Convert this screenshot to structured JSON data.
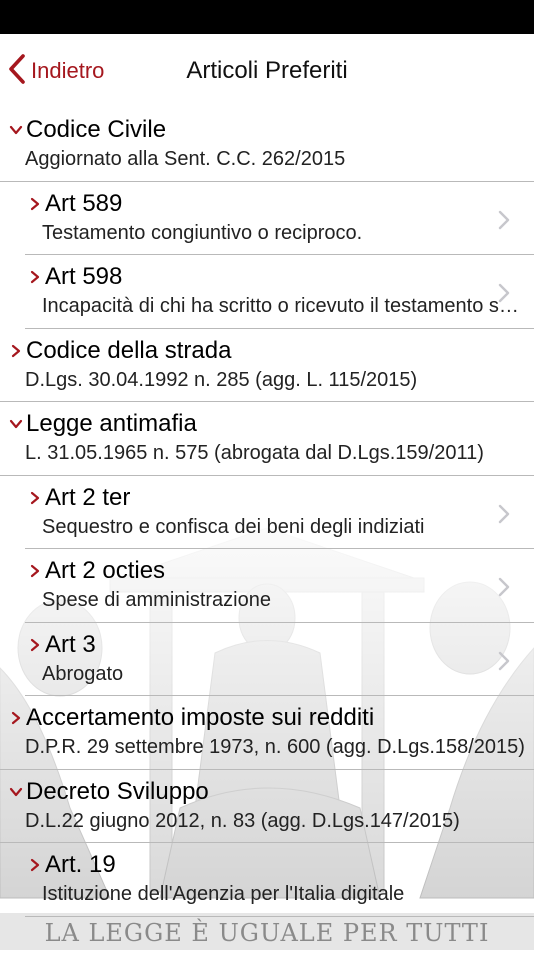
{
  "nav": {
    "back_label": "Indietro",
    "title": "Articoli Preferiti"
  },
  "colors": {
    "accent": "#a5171e",
    "caret": "#a5171e",
    "chevron": "#c7c7cc"
  },
  "rows": [
    {
      "level": 0,
      "expanded": true,
      "title": "Codice Civile",
      "subtitle": "Aggiornato alla Sent. C.C. 262/2015"
    },
    {
      "level": 1,
      "expanded": false,
      "title": "Art 589",
      "subtitle": "Testamento congiuntivo o reciproco.",
      "chevron": true
    },
    {
      "level": 1,
      "expanded": false,
      "title": "Art 598",
      "subtitle": "Incapacità di chi ha scritto o ricevuto il testamento segreto.",
      "chevron": true
    },
    {
      "level": 0,
      "expanded": false,
      "title": "Codice della strada",
      "subtitle": "D.Lgs. 30.04.1992 n. 285 (agg. L. 115/2015)"
    },
    {
      "level": 0,
      "expanded": true,
      "title": "Legge antimafia",
      "subtitle": "L. 31.05.1965 n. 575 (abrogata dal D.Lgs.159/2011)"
    },
    {
      "level": 1,
      "expanded": false,
      "title": "Art 2 ter",
      "subtitle": "Sequestro e confisca dei beni degli indiziati",
      "chevron": true
    },
    {
      "level": 1,
      "expanded": false,
      "title": "Art 2 octies",
      "subtitle": "Spese di amministrazione",
      "chevron": true
    },
    {
      "level": 1,
      "expanded": false,
      "title": "Art 3",
      "subtitle": "Abrogato",
      "chevron": true
    },
    {
      "level": 0,
      "expanded": false,
      "title": "Accertamento imposte sui redditi",
      "subtitle": "D.P.R. 29 settembre 1973, n. 600 (agg. D.Lgs.158/2015)"
    },
    {
      "level": 0,
      "expanded": true,
      "title": "Decreto Sviluppo",
      "subtitle": "D.L.22 giugno 2012, n. 83 (agg. D.Lgs.147/2015)"
    },
    {
      "level": 1,
      "expanded": false,
      "title": "Art. 19",
      "subtitle": "Istituzione dell'Agenzia per l'Italia digitale",
      "chevron": false
    }
  ],
  "background_motto": "LA LEGGE È UGUALE PER TUTTI"
}
